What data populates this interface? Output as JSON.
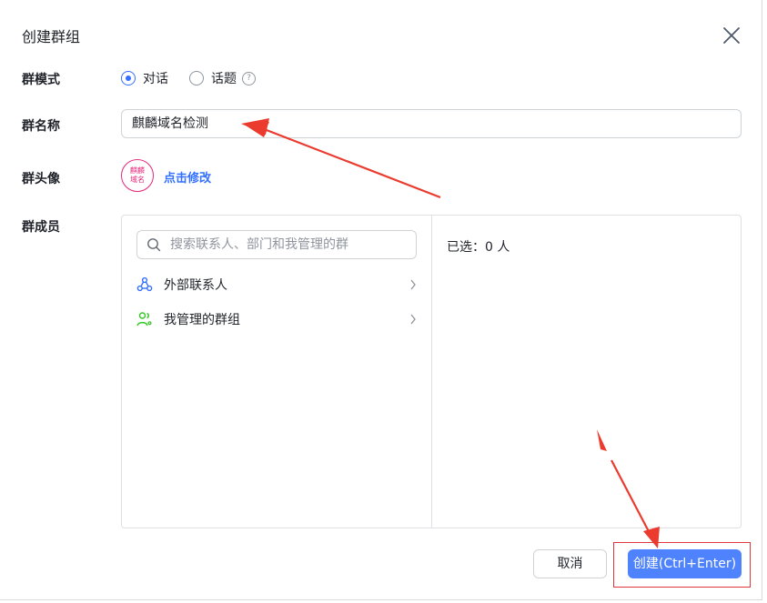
{
  "dialog": {
    "title": "创建群组"
  },
  "form": {
    "mode_label": "群模式",
    "mode_options": [
      {
        "label": "对话",
        "checked": true
      },
      {
        "label": "话题",
        "checked": false
      }
    ],
    "name_label": "群名称",
    "name_value": "麒麟域名检测",
    "avatar_label": "群头像",
    "avatar_text": "麒麟域名",
    "avatar_modify": "点击修改",
    "members_label": "群成员"
  },
  "members": {
    "search_placeholder": "搜索联系人、部门和我管理的群",
    "items": [
      {
        "label": "外部联系人",
        "icon": "external-contacts-icon"
      },
      {
        "label": "我管理的群组",
        "icon": "managed-groups-icon"
      }
    ],
    "selected_text": "已选：0 人"
  },
  "footer": {
    "cancel_label": "取消",
    "create_label": "创建(Ctrl+Enter)"
  },
  "colors": {
    "accent": "#3370ff",
    "primary_button": "#4e83fd",
    "annotation_red": "#e0353a",
    "avatar_pink": "#e5277b"
  }
}
